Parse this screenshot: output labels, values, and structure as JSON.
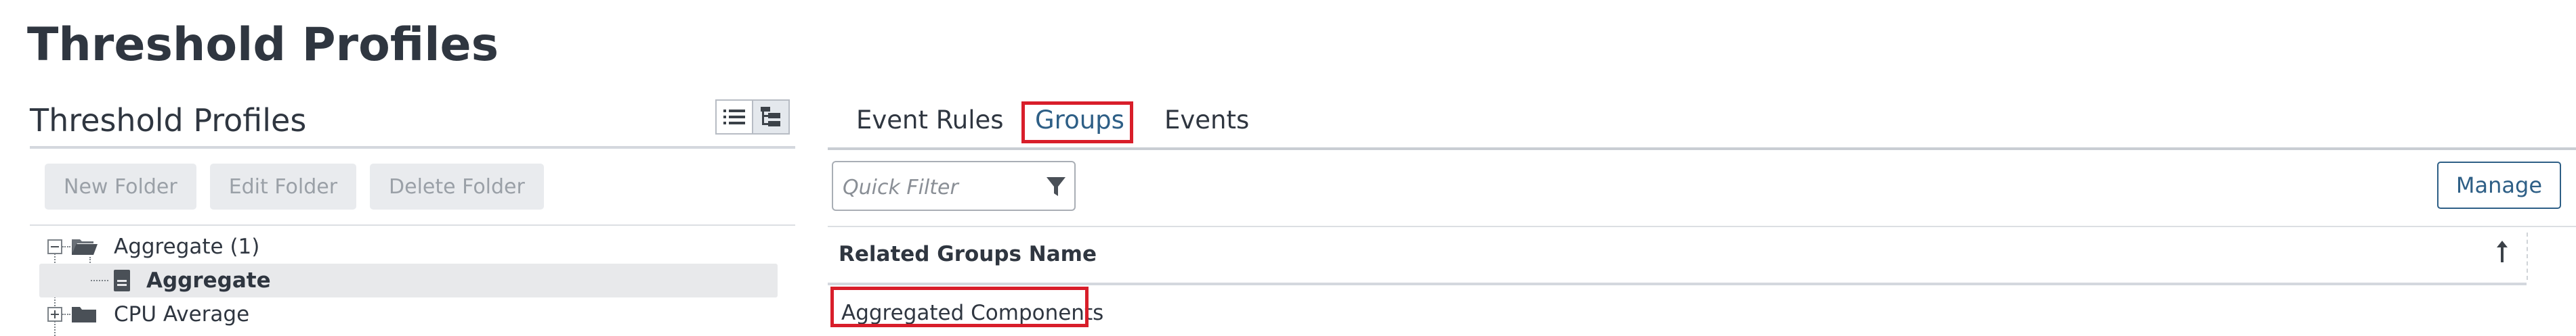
{
  "page": {
    "title": "Threshold Profiles"
  },
  "left_panel": {
    "title": "Threshold Profiles",
    "view_toggle": {
      "list_icon": "list-view-icon",
      "tree_icon": "tree-view-icon",
      "active": "tree"
    },
    "toolbar": {
      "new_folder": "New Folder",
      "edit_folder": "Edit Folder",
      "delete_folder": "Delete Folder"
    },
    "tree": [
      {
        "label": "Aggregate (1)",
        "type": "folder-open",
        "expanded": true
      },
      {
        "label": "Aggregate",
        "type": "profile",
        "selected": true
      },
      {
        "label": "CPU Average",
        "type": "folder",
        "expanded": false
      }
    ]
  },
  "right_panel": {
    "tabs": [
      {
        "label": "Event Rules",
        "active": false
      },
      {
        "label": "Groups",
        "active": true,
        "highlighted": true
      },
      {
        "label": "Events",
        "active": false
      }
    ],
    "quick_filter": {
      "placeholder": "Quick Filter",
      "icon": "filter-icon"
    },
    "manage_label": "Manage",
    "grid": {
      "columns": [
        {
          "label": "Related Groups Name",
          "sort": "ascending"
        }
      ],
      "rows": [
        {
          "name": "Aggregated Components",
          "highlighted": true
        }
      ]
    }
  },
  "colors": {
    "accent": "#2e5f86",
    "highlight": "#d81e2a",
    "selected_row": "#e8e9eb",
    "disabled_button": "#e9ebee"
  }
}
